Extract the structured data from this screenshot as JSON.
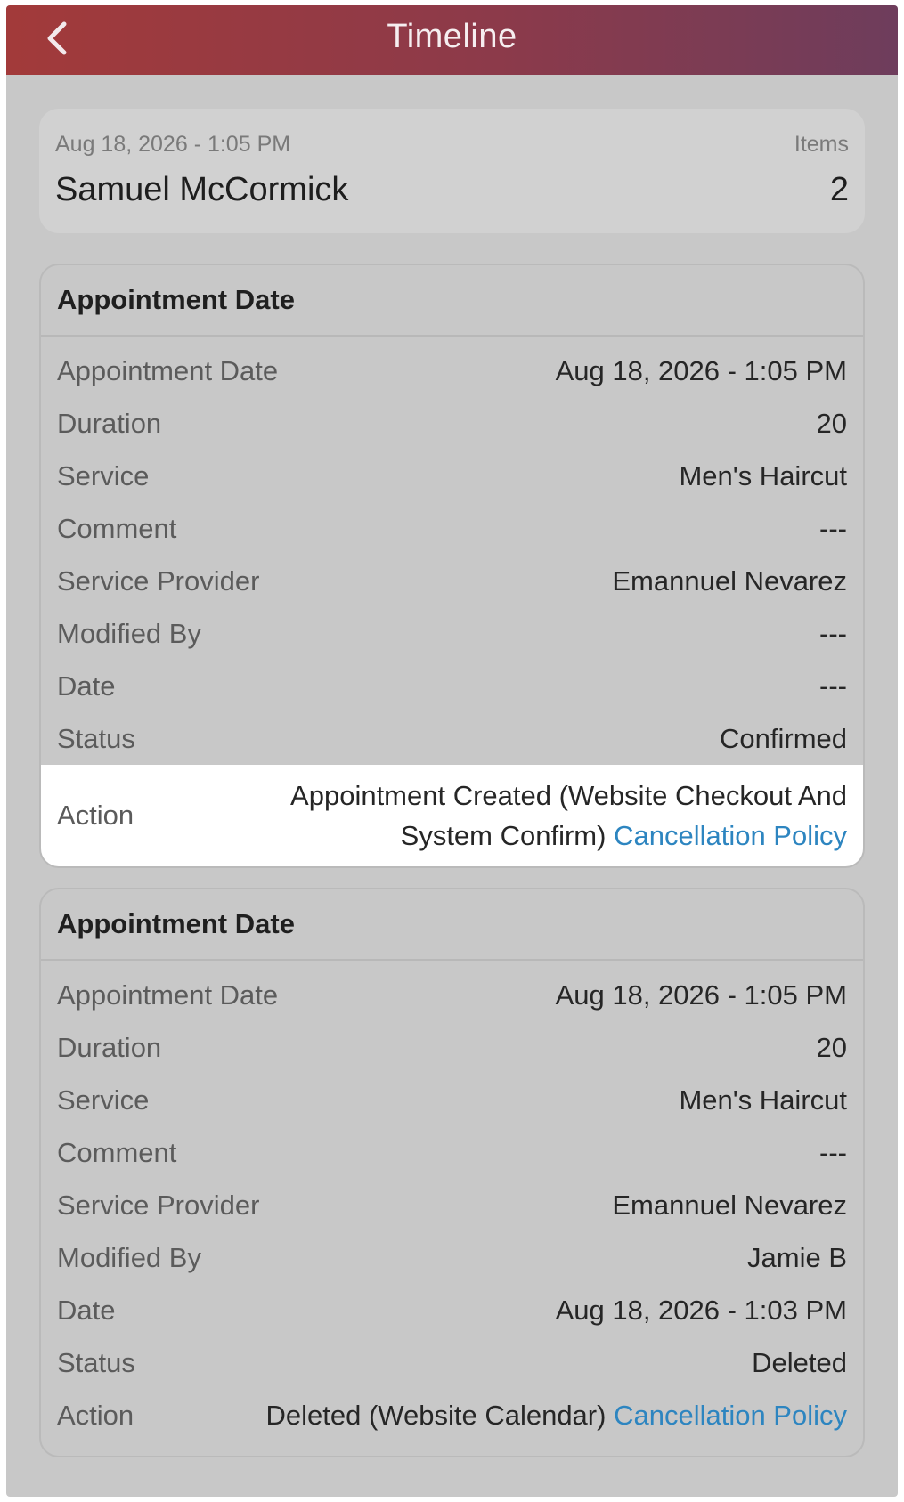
{
  "header": {
    "title": "Timeline"
  },
  "summary": {
    "date": "Aug 18, 2026 - 1:05 PM",
    "items_label": "Items",
    "name": "Samuel McCormick",
    "items_count": "2"
  },
  "cards": [
    {
      "title": "Appointment Date",
      "rows": [
        {
          "label": "Appointment Date",
          "value": "Aug 18, 2026 - 1:05 PM"
        },
        {
          "label": "Duration",
          "value": "20"
        },
        {
          "label": "Service",
          "value": "Men's Haircut"
        },
        {
          "label": "Comment",
          "value": "---"
        },
        {
          "label": "Service Provider",
          "value": "Emannuel Nevarez"
        },
        {
          "label": "Modified By",
          "value": "---"
        },
        {
          "label": "Date",
          "value": "---"
        },
        {
          "label": "Status",
          "value": "Confirmed"
        }
      ],
      "action": {
        "label": "Action",
        "text": "Appointment Created (Website Checkout And System Confirm)",
        "link": "Cancellation Policy"
      }
    },
    {
      "title": "Appointment Date",
      "rows": [
        {
          "label": "Appointment Date",
          "value": "Aug 18, 2026 - 1:05 PM"
        },
        {
          "label": "Duration",
          "value": "20"
        },
        {
          "label": "Service",
          "value": "Men's Haircut"
        },
        {
          "label": "Comment",
          "value": "---"
        },
        {
          "label": "Service Provider",
          "value": "Emannuel Nevarez"
        },
        {
          "label": "Modified By",
          "value": "Jamie B"
        },
        {
          "label": "Date",
          "value": "Aug 18, 2026 - 1:03 PM"
        },
        {
          "label": "Status",
          "value": "Deleted"
        }
      ],
      "action": {
        "label": "Action",
        "text": "Deleted (Website Calendar)",
        "link": "Cancellation Policy"
      }
    }
  ]
}
